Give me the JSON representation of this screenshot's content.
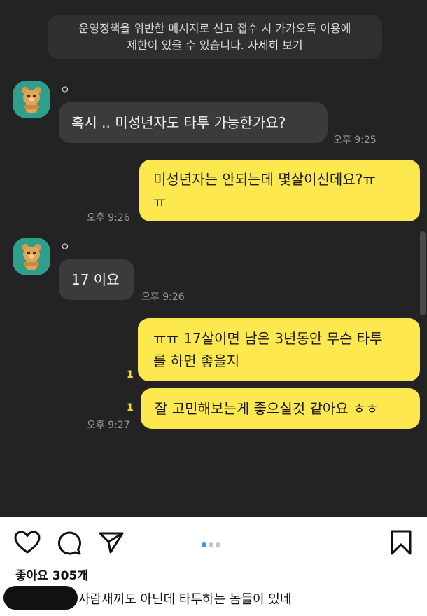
{
  "notice": {
    "text": "운영정책을 위반한 메시지로 신고 접수 시 카카오톡 이용에",
    "text2": "제한이 있을 수 있습니다.",
    "link": "자세히 보기"
  },
  "sender": {
    "name": "ㅇ",
    "avatar_icon": "bear-avatar-icon"
  },
  "messages": [
    {
      "dir": "in",
      "text": "혹시 .. 미성년자도 타투 가능한가요?",
      "time": "오후 9:25"
    },
    {
      "dir": "out",
      "line1": "미성년자는 안되는데 몇살이신데요?ㅠ",
      "line2": "ㅠ",
      "time": "오후 9:26"
    },
    {
      "dir": "in",
      "text": "17 이요",
      "time": "오후 9:26"
    },
    {
      "dir": "out",
      "line1": "ㅠㅠ 17살이면 남은 3년동안 무슨 타투",
      "line2": "를 하면 좋을지",
      "unread": "1"
    },
    {
      "dir": "out",
      "text": "잘 고민해보는게 좋으실것 같아요 ㅎㅎ",
      "unread": "1",
      "time": "오후 9:27"
    }
  ],
  "instagram": {
    "likes": "좋아요 305개",
    "comment": "사람새끼도 아닌데 타투하는 놈들이 있네",
    "icons": [
      "heart-icon",
      "comment-icon",
      "share-icon",
      "bookmark-icon"
    ]
  },
  "colors": {
    "chat_bg": "#232323",
    "outgoing_bubble": "#fde84f",
    "incoming_bubble": "#3b3b3b",
    "accent_dot": "#3897f0"
  }
}
